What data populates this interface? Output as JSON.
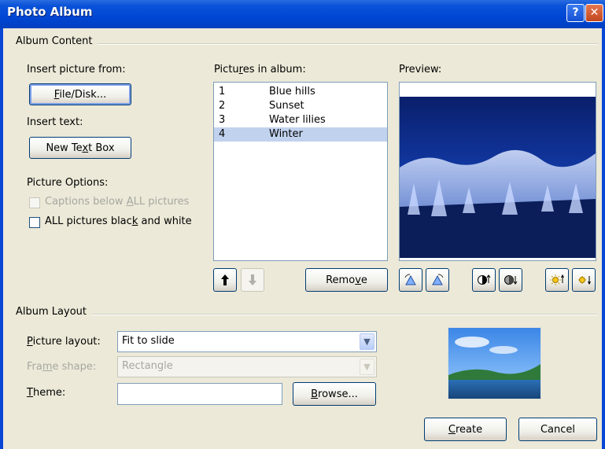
{
  "window": {
    "title": "Photo Album",
    "help_label": "?",
    "close_label": "✕"
  },
  "album_content": {
    "group_label": "Album Content",
    "insert_picture_from": "Insert picture from:",
    "file_disk_button": {
      "pre": "",
      "mnemonic": "F",
      "post": "ile/Disk..."
    },
    "insert_text": "Insert text:",
    "new_text_box_button": {
      "pre": "New Te",
      "mnemonic": "x",
      "post": "t Box"
    },
    "picture_options": "Picture Options:",
    "captions_option": {
      "pre": "Captions below ",
      "mnemonic": "A",
      "post": "LL pictures",
      "checked": false,
      "enabled": false
    },
    "bw_option": {
      "pre": "ALL pictures blac",
      "mnemonic": "k",
      "post": " and white",
      "checked": false,
      "enabled": true
    },
    "pictures_in_album": {
      "pre": "Pictu",
      "mnemonic": "r",
      "post": "es in album:"
    },
    "pictures": [
      {
        "num": "1",
        "name": "Blue hills",
        "selected": false
      },
      {
        "num": "2",
        "name": "Sunset",
        "selected": false
      },
      {
        "num": "3",
        "name": "Water lilies",
        "selected": false
      },
      {
        "num": "4",
        "name": "Winter",
        "selected": true
      }
    ],
    "move_up_icon": "up-arrow-icon",
    "move_down_icon": "down-arrow-icon",
    "remove_button": {
      "pre": "Remo",
      "mnemonic": "v",
      "post": "e"
    },
    "preview_label": "Preview:"
  },
  "album_layout": {
    "group_label": "Album Layout",
    "picture_layout_label": {
      "pre": "",
      "mnemonic": "P",
      "post": "icture layout:"
    },
    "picture_layout_value": "Fit to slide",
    "frame_shape_label": {
      "pre": "Fra",
      "mnemonic": "m",
      "post": "e shape:"
    },
    "frame_shape_value": "Rectangle",
    "theme_label": {
      "pre": "",
      "mnemonic": "T",
      "post": "heme:"
    },
    "theme_value": "",
    "browse_button": {
      "pre": "",
      "mnemonic": "B",
      "post": "rowse..."
    }
  },
  "footer": {
    "create_button": {
      "pre": "",
      "mnemonic": "C",
      "post": "reate"
    },
    "cancel_button": "Cancel"
  },
  "colors": {
    "titlebar": "#0046d5",
    "dialog_bg": "#ece9d8",
    "selection": "#c1d2ee",
    "border": "#7f9db9"
  }
}
